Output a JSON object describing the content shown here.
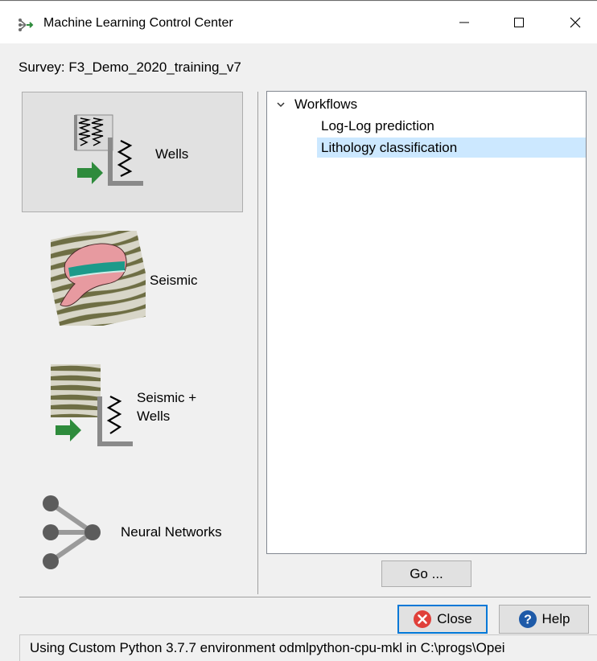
{
  "window": {
    "title": "Machine Learning Control Center",
    "controls": [
      "minimize",
      "maximize",
      "close"
    ]
  },
  "survey_label": "Survey: F3_Demo_2020_training_v7",
  "categories": [
    {
      "label": "Wells",
      "icon": "wells-icon",
      "selected": true
    },
    {
      "label": "Seismic",
      "icon": "seismic-icon",
      "selected": false
    },
    {
      "label_line1": "Seismic +",
      "label_line2": "Wells",
      "icon": "seismic-wells-icon",
      "selected": false
    },
    {
      "label": "Neural Networks",
      "icon": "neural-networks-icon",
      "selected": false
    }
  ],
  "tree": {
    "root": "Workflows",
    "items": [
      "Log-Log prediction",
      "Lithology classification"
    ],
    "selected_item": "Lithology classification"
  },
  "buttons": {
    "go": "Go ...",
    "close": "Close",
    "help": "Help"
  },
  "status_text": "Using Custom Python 3.7.7 environment odmlpython-cpu-mkl in C:\\progs\\Opei",
  "colors": {
    "selection": "#cce8ff",
    "focus": "#0078d7",
    "close_icon": "#e0403a",
    "help_icon": "#1e5aa8",
    "arrow_green": "#2e8b3c"
  }
}
